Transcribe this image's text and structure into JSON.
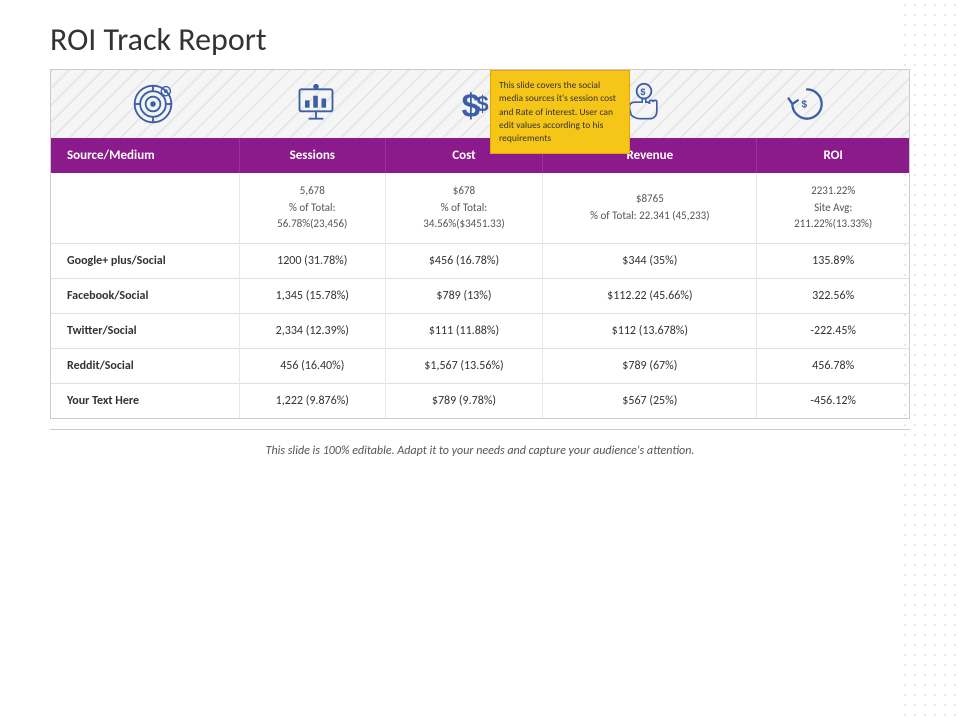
{
  "page": {
    "title": "ROI Track Report",
    "footer": "This slide is 100% editable. Adapt it to your needs and capture your audience's attention."
  },
  "tooltip": {
    "text": "This slide covers the social media sources it's session cost and Rate of interest. User can edit values according to his requirements"
  },
  "icons": [
    {
      "name": "target-icon",
      "unicode": "🎯"
    },
    {
      "name": "presentation-icon",
      "unicode": "📊"
    },
    {
      "name": "dollar-icon",
      "unicode": "💲"
    },
    {
      "name": "hand-money-icon",
      "unicode": "🤝"
    },
    {
      "name": "refresh-money-icon",
      "unicode": "🔄"
    }
  ],
  "table": {
    "headers": [
      "Source/Medium",
      "Sessions",
      "Cost",
      "Revenue",
      "ROI"
    ],
    "summary_row": {
      "source": "",
      "sessions": "5,678\n% of Total:\n56.78%(23,456)",
      "cost": "$678\n% of Total:\n34.56%($3451.33)",
      "revenue": "$8765\n% of Total: 22.341 (45,233)",
      "roi": "2231.22%\nSite Avg:\n211.22%(13.33%)"
    },
    "rows": [
      {
        "source": "Google+ plus/Social",
        "sessions": "1200 (31.78%)",
        "cost": "$456 (16.78%)",
        "revenue": "$344 (35%)",
        "roi": "135.89%"
      },
      {
        "source": "Facebook/Social",
        "sessions": "1,345 (15.78%)",
        "cost": "$789 (13%)",
        "revenue": "$112.22 (45.66%)",
        "roi": "322.56%"
      },
      {
        "source": "Twitter/Social",
        "sessions": "2,334 (12.39%)",
        "cost": "$111 (11.88%)",
        "revenue": "$112 (13.678%)",
        "roi": "-222.45%"
      },
      {
        "source": "Reddit/Social",
        "sessions": "456 (16.40%)",
        "cost": "$1,567 (13.56%)",
        "revenue": "$789 (67%)",
        "roi": "456.78%"
      },
      {
        "source": "Your Text Here",
        "sessions": "1,222 (9.876%)",
        "cost": "$789 (9.78%)",
        "revenue": "$567 (25%)",
        "roi": "-456.12%"
      }
    ]
  }
}
